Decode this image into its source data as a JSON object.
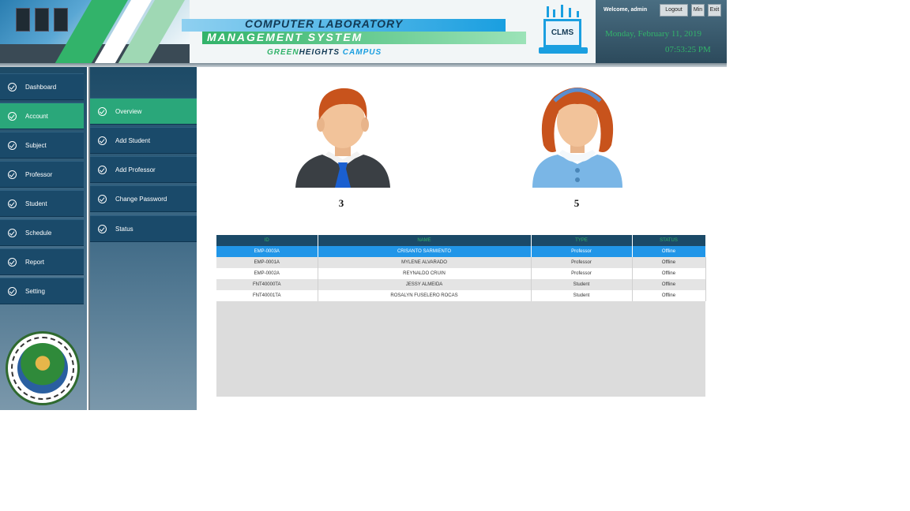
{
  "header": {
    "title_line1": "COMPUTER LABORATORY",
    "title_line2": "MANAGEMENT SYSTEM",
    "campus_part1": "GREEN",
    "campus_part2": "HEIGHTS",
    "campus_part3": " CAMPUS",
    "logo_text": "CLMS",
    "welcome": "Welcome, admin",
    "logout_label": "Logout",
    "min_label": "Min",
    "exit_label": "Exit",
    "date": "Monday, February 11, 2019",
    "time": "07:53:25 PM"
  },
  "sidebar": {
    "items": [
      {
        "label": "Dashboard",
        "active": false
      },
      {
        "label": "Account",
        "active": true
      },
      {
        "label": "Subject",
        "active": false
      },
      {
        "label": "Professor",
        "active": false
      },
      {
        "label": "Student",
        "active": false
      },
      {
        "label": "Schedule",
        "active": false
      },
      {
        "label": "Report",
        "active": false
      },
      {
        "label": "Setting",
        "active": false
      }
    ]
  },
  "subnav": {
    "items": [
      {
        "label": "Overview",
        "active": true
      },
      {
        "label": "Add Student",
        "active": false
      },
      {
        "label": "Add Professor",
        "active": false
      },
      {
        "label": "Change Password",
        "active": false
      },
      {
        "label": "Status",
        "active": false
      }
    ]
  },
  "overview": {
    "professor_count": "3",
    "student_count": "5"
  },
  "table": {
    "headers": [
      "ID",
      "NAME",
      "TYPE",
      "STATUS"
    ],
    "rows": [
      [
        "EMP-0003A",
        "CRISANTO SARMIENTO",
        "Professor",
        "Offline"
      ],
      [
        "EMP-0001A",
        "MYLENE ALVARADO",
        "Professor",
        "Offline"
      ],
      [
        "EMP-0002A",
        "REYNALDO CRUIN",
        "Professor",
        "Offline"
      ],
      [
        "FNT40000TA",
        "JESSY ALMEIDA",
        "Student",
        "Offline"
      ],
      [
        "FNT40001TA",
        "ROSALYN FUSELERO ROCAS",
        "Student",
        "Offline"
      ]
    ]
  },
  "colors": {
    "accent_green": "#2aa77a",
    "nav_blue": "#1a4a6a",
    "selected_row": "#2196e8"
  }
}
